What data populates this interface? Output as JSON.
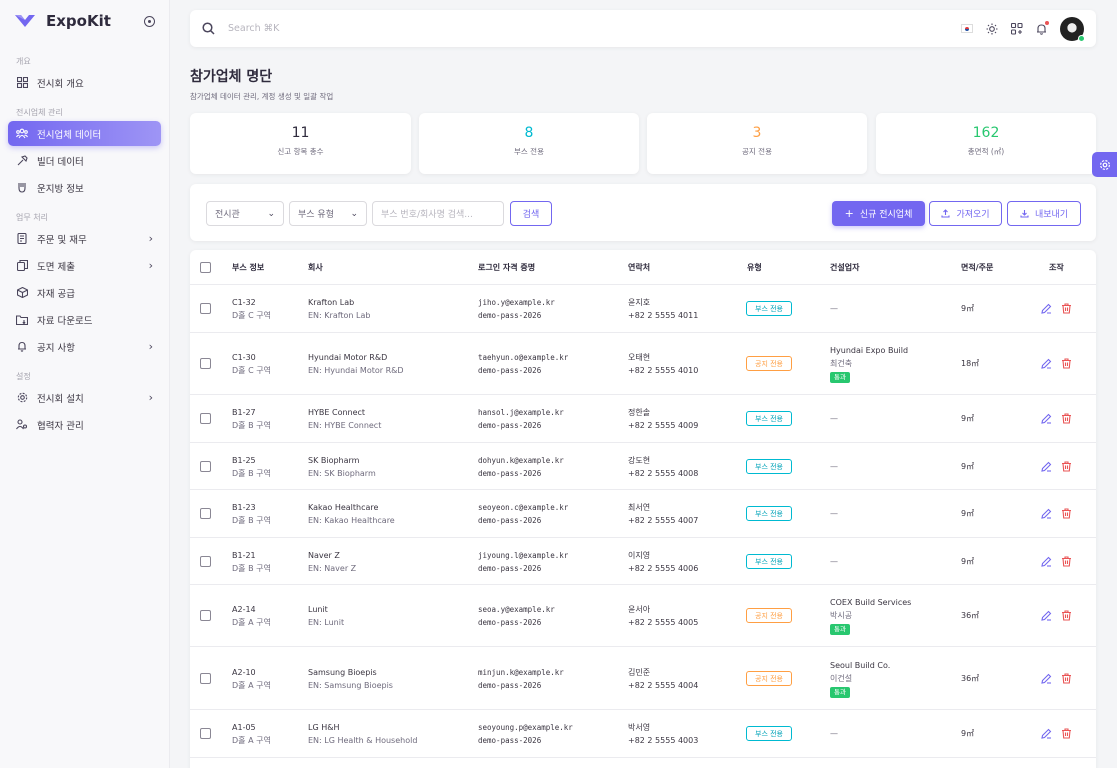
{
  "app": {
    "name": "ExpoKit"
  },
  "sidebar": {
    "sections": [
      {
        "title": "개요"
      },
      {
        "title": "전시업체 관리"
      },
      {
        "title": "업무 처리"
      },
      {
        "title": "설정"
      }
    ],
    "items": [
      {
        "label": "전시회 개요",
        "icon": "grid-icon"
      },
      {
        "label": "전시업체 데이터",
        "icon": "users-icon",
        "active": true
      },
      {
        "label": "빌더 데이터",
        "icon": "hammer-icon"
      },
      {
        "label": "운지방 정보",
        "icon": "shield-icon"
      },
      {
        "label": "주문 및 재무",
        "icon": "receipt-icon"
      },
      {
        "label": "도면 제출",
        "icon": "copy-icon"
      },
      {
        "label": "자재 공급",
        "icon": "box-icon"
      },
      {
        "label": "자료 다운로드",
        "icon": "folder-download-icon"
      },
      {
        "label": "공지 사항",
        "icon": "bell-icon"
      },
      {
        "label": "전시회 설치",
        "icon": "gear-icon"
      },
      {
        "label": "협력자 관리",
        "icon": "users-gear-icon"
      }
    ]
  },
  "topbar": {
    "search_placeholder": "Search ⌘K"
  },
  "page": {
    "title": "참가업체 명단",
    "subtitle": "참가업체 데이터 관리, 계정 생성 및 일괄 작업"
  },
  "stats": [
    {
      "value": "11",
      "label": "신고 항목 총수",
      "color": "#2f2b3d"
    },
    {
      "value": "8",
      "label": "부스 전용",
      "color": "#00bad1"
    },
    {
      "value": "3",
      "label": "공지 전용",
      "color": "#ff9f43"
    },
    {
      "value": "162",
      "label": "총면적 (㎡)",
      "color": "#28c76f"
    }
  ],
  "filters": {
    "hall_select": "전시관",
    "type_select": "부스 유형",
    "search_placeholder": "부스 번호/회사명 검색...",
    "search_button": "검색",
    "new_button": "신규 전시업체",
    "import_button": "가져오기",
    "export_button": "내보내기"
  },
  "table": {
    "headers": [
      "부스 정보",
      "회사",
      "로그인 자격 증명",
      "연락처",
      "유형",
      "건설업자",
      "면적/주문",
      "조작"
    ],
    "rows": [
      {
        "booth": "C1-32",
        "zone": "D홀 C 구역",
        "company": "Krafton Lab",
        "company_en": "EN: Krafton Lab",
        "email": "jiho.y@example.kr",
        "password": "demo-pass-2026",
        "contact": "윤지호",
        "phone": "+82 2 5555 4011",
        "type": "부스 전용",
        "type_kind": "booth",
        "builder": "—",
        "builder_person": "",
        "builder_status": "",
        "area": "9㎡"
      },
      {
        "booth": "C1-30",
        "zone": "D홀 C 구역",
        "company": "Hyundai Motor R&D",
        "company_en": "EN: Hyundai Motor R&D",
        "email": "taehyun.o@example.kr",
        "password": "demo-pass-2026",
        "contact": "오태현",
        "phone": "+82 2 5555 4010",
        "type": "공지 전용",
        "type_kind": "space",
        "builder": "Hyundai Expo Build",
        "builder_person": "최건축",
        "builder_status": "통과",
        "area": "18㎡"
      },
      {
        "booth": "B1-27",
        "zone": "D홀 B 구역",
        "company": "HYBE Connect",
        "company_en": "EN: HYBE Connect",
        "email": "hansol.j@example.kr",
        "password": "demo-pass-2026",
        "contact": "정한솔",
        "phone": "+82 2 5555 4009",
        "type": "부스 전용",
        "type_kind": "booth",
        "builder": "—",
        "builder_person": "",
        "builder_status": "",
        "area": "9㎡"
      },
      {
        "booth": "B1-25",
        "zone": "D홀 B 구역",
        "company": "SK Biopharm",
        "company_en": "EN: SK Biopharm",
        "email": "dohyun.k@example.kr",
        "password": "demo-pass-2026",
        "contact": "강도현",
        "phone": "+82 2 5555 4008",
        "type": "부스 전용",
        "type_kind": "booth",
        "builder": "—",
        "builder_person": "",
        "builder_status": "",
        "area": "9㎡"
      },
      {
        "booth": "B1-23",
        "zone": "D홀 B 구역",
        "company": "Kakao Healthcare",
        "company_en": "EN: Kakao Healthcare",
        "email": "seoyeon.c@example.kr",
        "password": "demo-pass-2026",
        "contact": "최서연",
        "phone": "+82 2 5555 4007",
        "type": "부스 전용",
        "type_kind": "booth",
        "builder": "—",
        "builder_person": "",
        "builder_status": "",
        "area": "9㎡"
      },
      {
        "booth": "B1-21",
        "zone": "D홀 B 구역",
        "company": "Naver Z",
        "company_en": "EN: Naver Z",
        "email": "jiyoung.l@example.kr",
        "password": "demo-pass-2026",
        "contact": "이지영",
        "phone": "+82 2 5555 4006",
        "type": "부스 전용",
        "type_kind": "booth",
        "builder": "—",
        "builder_person": "",
        "builder_status": "",
        "area": "9㎡"
      },
      {
        "booth": "A2-14",
        "zone": "D홀 A 구역",
        "company": "Lunit",
        "company_en": "EN: Lunit",
        "email": "seoa.y@example.kr",
        "password": "demo-pass-2026",
        "contact": "윤서아",
        "phone": "+82 2 5555 4005",
        "type": "공지 전용",
        "type_kind": "space",
        "builder": "COEX Build Services",
        "builder_person": "박시공",
        "builder_status": "통과",
        "area": "36㎡"
      },
      {
        "booth": "A2-10",
        "zone": "D홀 A 구역",
        "company": "Samsung Bioepis",
        "company_en": "EN: Samsung Bioepis",
        "email": "minjun.k@example.kr",
        "password": "demo-pass-2026",
        "contact": "김민준",
        "phone": "+82 2 5555 4004",
        "type": "공지 전용",
        "type_kind": "space",
        "builder": "Seoul Build Co.",
        "builder_person": "이건설",
        "builder_status": "통과",
        "area": "36㎡"
      },
      {
        "booth": "A1-05",
        "zone": "D홀 A 구역",
        "company": "LG H&H",
        "company_en": "EN: LG Health & Household",
        "email": "seoyoung.p@example.kr",
        "password": "demo-pass-2026",
        "contact": "박서영",
        "phone": "+82 2 5555 4003",
        "type": "부스 전용",
        "type_kind": "booth",
        "builder": "—",
        "builder_person": "",
        "builder_status": "",
        "area": "9㎡"
      }
    ]
  },
  "colors": {
    "accent": "#7367f0",
    "booth": "#00bad1",
    "space": "#ff9f43",
    "pass": "#28c76f",
    "danger": "#ea5455"
  }
}
